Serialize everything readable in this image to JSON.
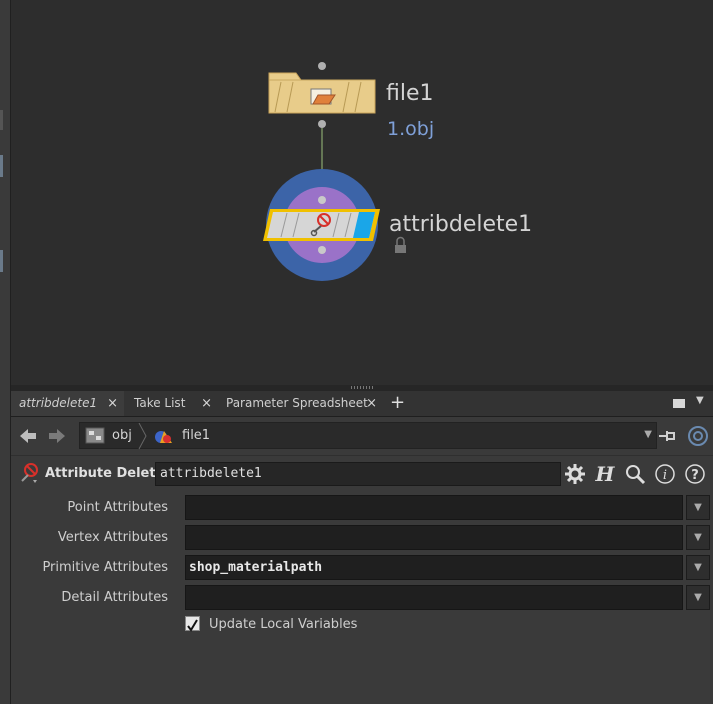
{
  "network": {
    "node1": {
      "name": "file1",
      "subtitle": "1.obj"
    },
    "node2": {
      "name": "attribdelete1"
    }
  },
  "tabs": [
    {
      "label": "attribdelete1",
      "active": true
    },
    {
      "label": "Take List",
      "active": false
    },
    {
      "label": "Parameter Spreadsheet",
      "active": false
    }
  ],
  "tab_add": "+",
  "tab_close": "×",
  "path": {
    "root": "obj",
    "node": "file1"
  },
  "param_header": {
    "op_type": "Attribute Delete",
    "node_name": "attribdelete1"
  },
  "params": [
    {
      "label": "Point Attributes",
      "value": ""
    },
    {
      "label": "Vertex Attributes",
      "value": ""
    },
    {
      "label": "Primitive Attributes",
      "value": "shop_materialpath"
    },
    {
      "label": "Detail Attributes",
      "value": ""
    }
  ],
  "checkbox": {
    "label": "Update Local Variables",
    "checked": true
  },
  "colors": {
    "accent_blue": "#1aa6e8",
    "node_ring": "#3c64a8",
    "node_inner": "#9a72c8",
    "file_node": "#e8cc8a",
    "selected_outline": "#f0c000"
  }
}
